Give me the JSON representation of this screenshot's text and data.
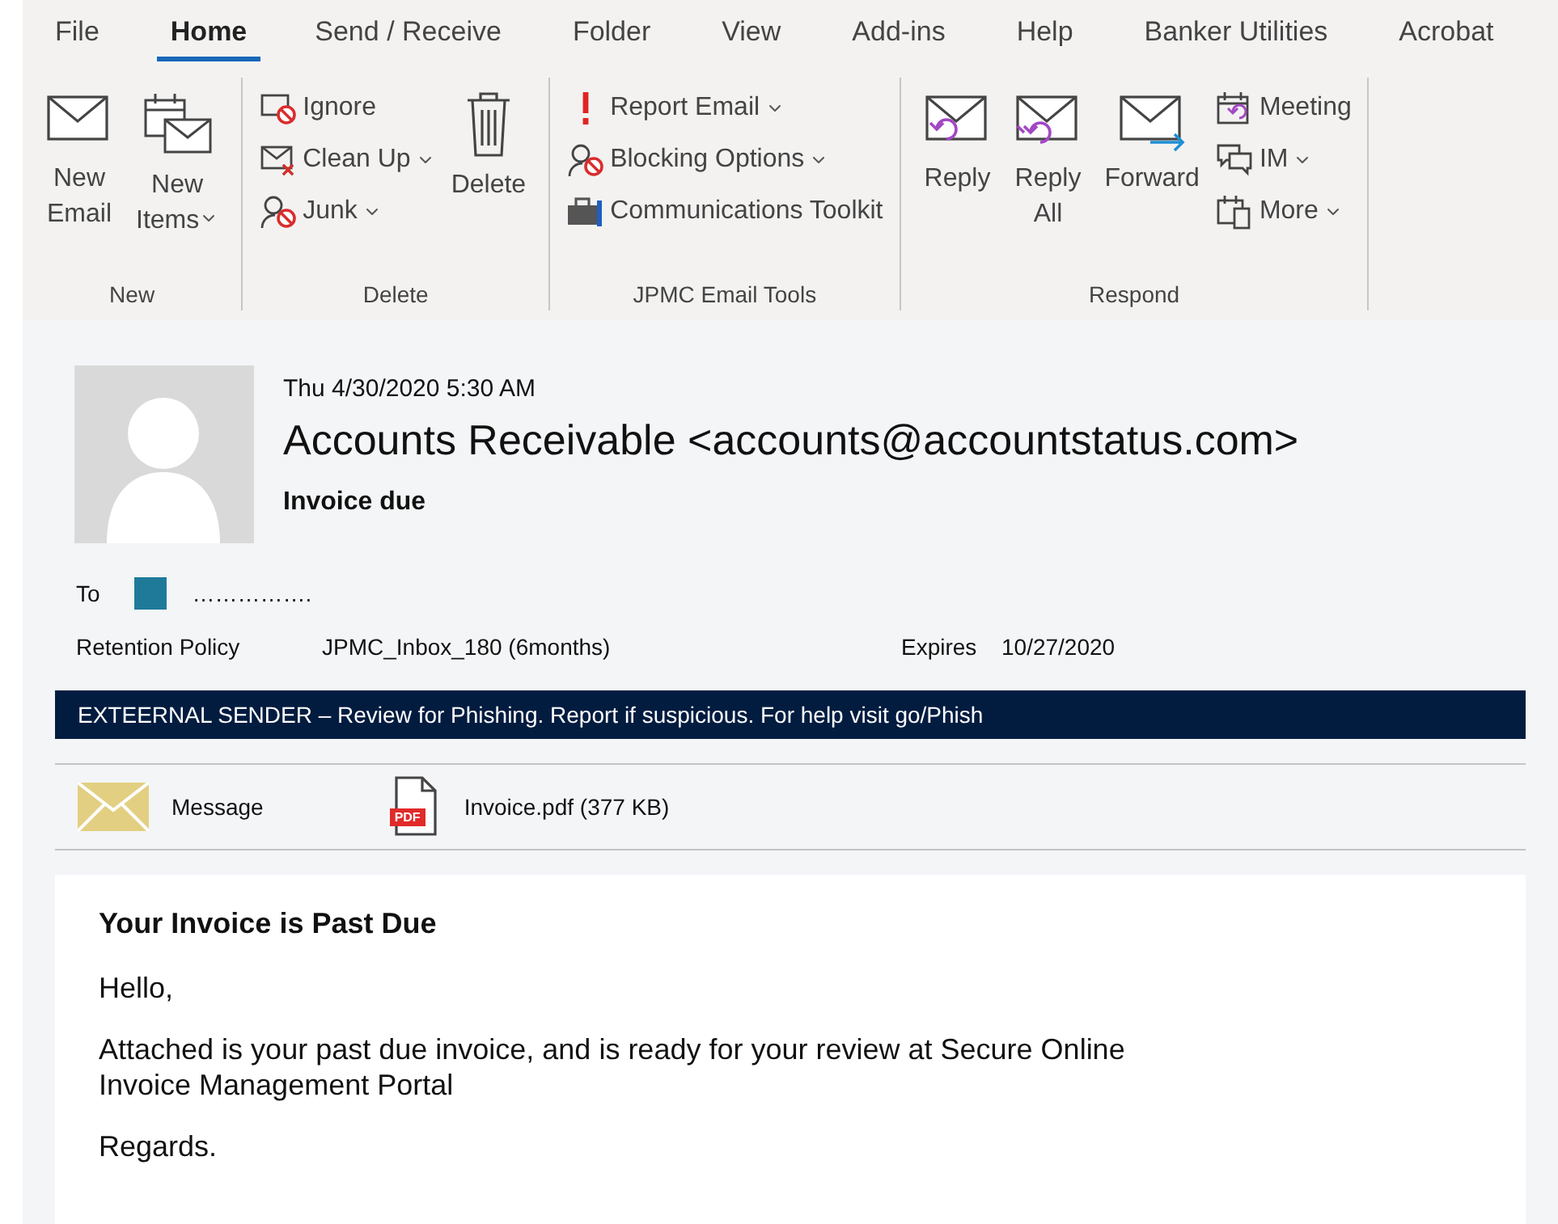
{
  "tabs": [
    {
      "label": "File",
      "selected": false
    },
    {
      "label": "Home",
      "selected": true
    },
    {
      "label": "Send / Receive",
      "selected": false
    },
    {
      "label": "Folder",
      "selected": false
    },
    {
      "label": "View",
      "selected": false
    },
    {
      "label": "Add-ins",
      "selected": false
    },
    {
      "label": "Help",
      "selected": false
    },
    {
      "label": "Banker Utilities",
      "selected": false
    },
    {
      "label": "Acrobat",
      "selected": false
    }
  ],
  "ribbon_groups": [
    {
      "label": "New",
      "items": [
        {
          "label": "New\nEmail",
          "kind": "large",
          "dropdown": false
        },
        {
          "label": "New\nItems",
          "kind": "large",
          "dropdown": true
        }
      ]
    },
    {
      "label": "Delete",
      "items": [
        {
          "label": "Ignore",
          "kind": "small",
          "dropdown": false
        },
        {
          "label": "Clean Up",
          "kind": "small",
          "dropdown": true
        },
        {
          "label": "Junk",
          "kind": "small",
          "dropdown": true
        },
        {
          "label": "Delete",
          "kind": "large",
          "dropdown": false
        }
      ]
    },
    {
      "label": "JPMC Email Tools",
      "items": [
        {
          "label": "Report Email",
          "kind": "small",
          "dropdown": true
        },
        {
          "label": "Blocking Options",
          "kind": "small",
          "dropdown": true
        },
        {
          "label": "Communications Toolkit",
          "kind": "small",
          "dropdown": false
        }
      ]
    },
    {
      "label": "Respond",
      "items": [
        {
          "label": "Reply",
          "kind": "large",
          "dropdown": false
        },
        {
          "label": "Reply\nAll",
          "kind": "large",
          "dropdown": false
        },
        {
          "label": "Forward",
          "kind": "large",
          "dropdown": false
        },
        {
          "label": "Meeting",
          "kind": "small",
          "dropdown": false
        },
        {
          "label": "IM",
          "kind": "small",
          "dropdown": true
        },
        {
          "label": "More",
          "kind": "small",
          "dropdown": true
        }
      ]
    }
  ],
  "message": {
    "date": "Thu 4/30/2020 5:30 AM",
    "sender": "Accounts Receivable <accounts@accountstatus.com>",
    "subject": "Invoice due",
    "to_label": "To",
    "recipient": "…………….",
    "retention_label": "Retention Policy",
    "retention_value": "JPMC_Inbox_180 (6months)",
    "expires_label": "Expires",
    "expires_value": "10/27/2020",
    "banner": "EXTEERNAL SENDER – Review for Phishing. Report if suspicious. For help visit go/Phish",
    "attachments": [
      {
        "kind": "message",
        "label": "Message"
      },
      {
        "kind": "pdf",
        "badge": "PDF",
        "label": "Invoice.pdf (377 KB)"
      }
    ]
  },
  "body": {
    "heading": "Your Invoice is Past Due",
    "paragraphs": [
      "Hello,",
      "Attached is your past due invoice, and is ready for your review at Secure Online\nInvoice Management Portal",
      "Regards."
    ]
  }
}
